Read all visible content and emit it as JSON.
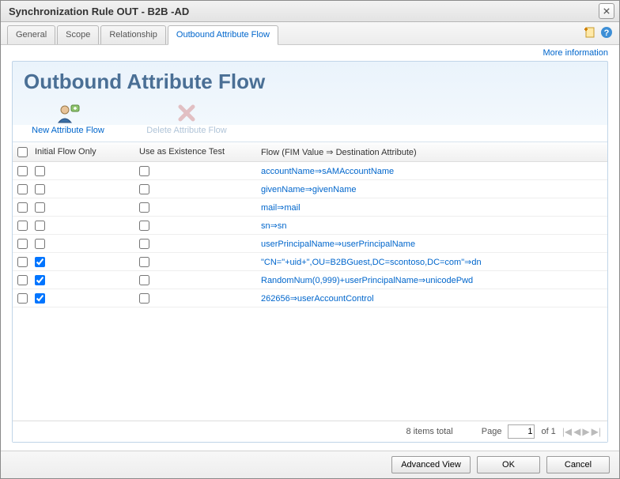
{
  "window": {
    "title": "Synchronization Rule OUT - B2B -AD"
  },
  "tabs": {
    "general": "General",
    "scope": "Scope",
    "relationship": "Relationship",
    "outbound": "Outbound Attribute Flow"
  },
  "more_info": "More information",
  "panel": {
    "heading": "Outbound Attribute Flow",
    "tool_new": "New Attribute Flow",
    "tool_delete": "Delete Attribute Flow"
  },
  "columns": {
    "initial": "Initial Flow Only",
    "existence": "Use as Existence Test",
    "flow": "Flow (FIM Value ⇒ Destination Attribute)"
  },
  "rows": [
    {
      "initial": false,
      "exist": false,
      "flow": "accountName⇒sAMAccountName"
    },
    {
      "initial": false,
      "exist": false,
      "flow": "givenName⇒givenName"
    },
    {
      "initial": false,
      "exist": false,
      "flow": "mail⇒mail"
    },
    {
      "initial": false,
      "exist": false,
      "flow": "sn⇒sn"
    },
    {
      "initial": false,
      "exist": false,
      "flow": "userPrincipalName⇒userPrincipalName"
    },
    {
      "initial": true,
      "exist": false,
      "flow": "\"CN=\"+uid+\",OU=B2BGuest,DC=scontoso,DC=com\"⇒dn"
    },
    {
      "initial": true,
      "exist": false,
      "flow": "RandomNum(0,999)+userPrincipalName⇒unicodePwd"
    },
    {
      "initial": true,
      "exist": false,
      "flow": "262656⇒userAccountControl"
    }
  ],
  "footer": {
    "items_total": "8 items total",
    "page_label": "Page",
    "page_value": "1",
    "of_total": "of 1"
  },
  "buttons": {
    "advanced": "Advanced View",
    "ok": "OK",
    "cancel": "Cancel"
  }
}
